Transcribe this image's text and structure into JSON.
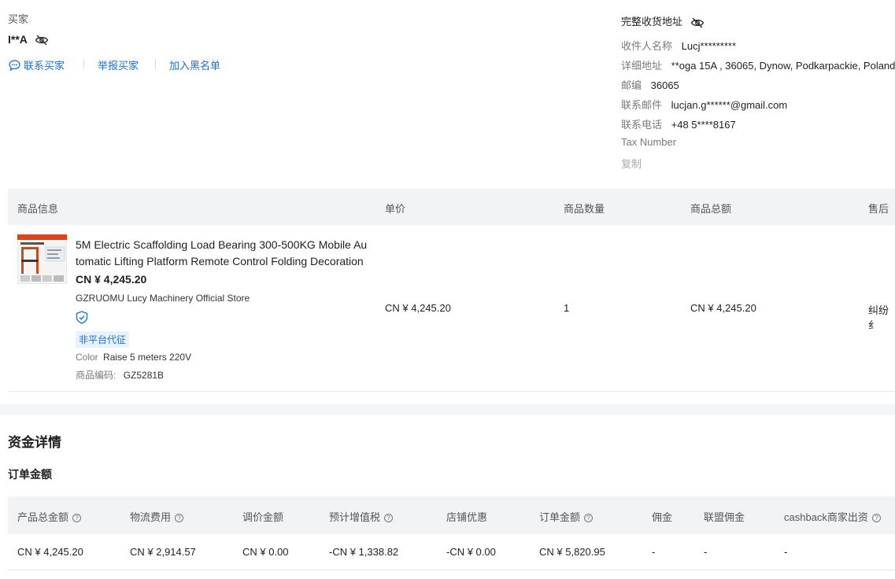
{
  "buyer": {
    "section_label": "买家",
    "name": "I**A",
    "links": {
      "contact": "联系买家",
      "report": "举报买家",
      "blacklist": "加入黑名单"
    }
  },
  "address": {
    "title": "完整收货地址",
    "recipient_label": "收件人名称",
    "recipient_value": "Lucj*********",
    "detail_label": "详细地址",
    "detail_value": "**oga 15A , 36065, Dynow, Podkarpackie, Poland",
    "zip_label": "邮编",
    "zip_value": "36065",
    "email_label": "联系邮件",
    "email_value": "lucjan.g******@gmail.com",
    "phone_label": "联系电话",
    "phone_value": "+48 5****8167",
    "tax_label": "Tax Number",
    "copy_label": "复制"
  },
  "product_table": {
    "headers": {
      "info": "商品信息",
      "unit_price": "单价",
      "quantity": "商品数量",
      "total": "商品总额",
      "after_sale": "售后"
    },
    "row": {
      "title_line1": "5M Electric Scaffolding Load Bearing 300-500KG Mobile Au",
      "title_line2": "tomatic Lifting Platform Remote Control Folding Decoration",
      "price": "CN ¥ 4,245.20",
      "store": "GZRUOMU Lucy Machinery Official Store",
      "tag": "非平台代征",
      "color_label": "Color",
      "color_value": "Raise 5 meters 220V",
      "code_label": "商品编码:",
      "code_value": "GZ5281B",
      "unit_price": "CN ¥ 4,245.20",
      "quantity": "1",
      "total": "CN ¥ 4,245.20",
      "after_sale": "纠纷纟"
    }
  },
  "funds": {
    "title": "资金详情",
    "subtitle": "订单金额",
    "headers": {
      "product_total": "产品总金额",
      "logistics": "物流费用",
      "price_adjust": "调价金额",
      "vat": "预计增值税",
      "store_discount": "店铺优惠",
      "order_amount": "订单金额",
      "commission": "佣金",
      "affiliate": "联盟佣金",
      "cashback": "cashback商家出资"
    },
    "values": {
      "product_total": "CN ¥ 4,245.20",
      "logistics": "CN ¥ 2,914.57",
      "price_adjust": "CN ¥ 0.00",
      "vat": "-CN ¥ 1,338.82",
      "store_discount": "-CN ¥ 0.00",
      "order_amount": "CN ¥ 5,820.95",
      "commission": "-",
      "affiliate": "-",
      "cashback": "-"
    }
  },
  "colors": {
    "link": "#1a6fd1",
    "header_bg": "#f2f3f5",
    "tag_bg": "#e8f2fd"
  }
}
